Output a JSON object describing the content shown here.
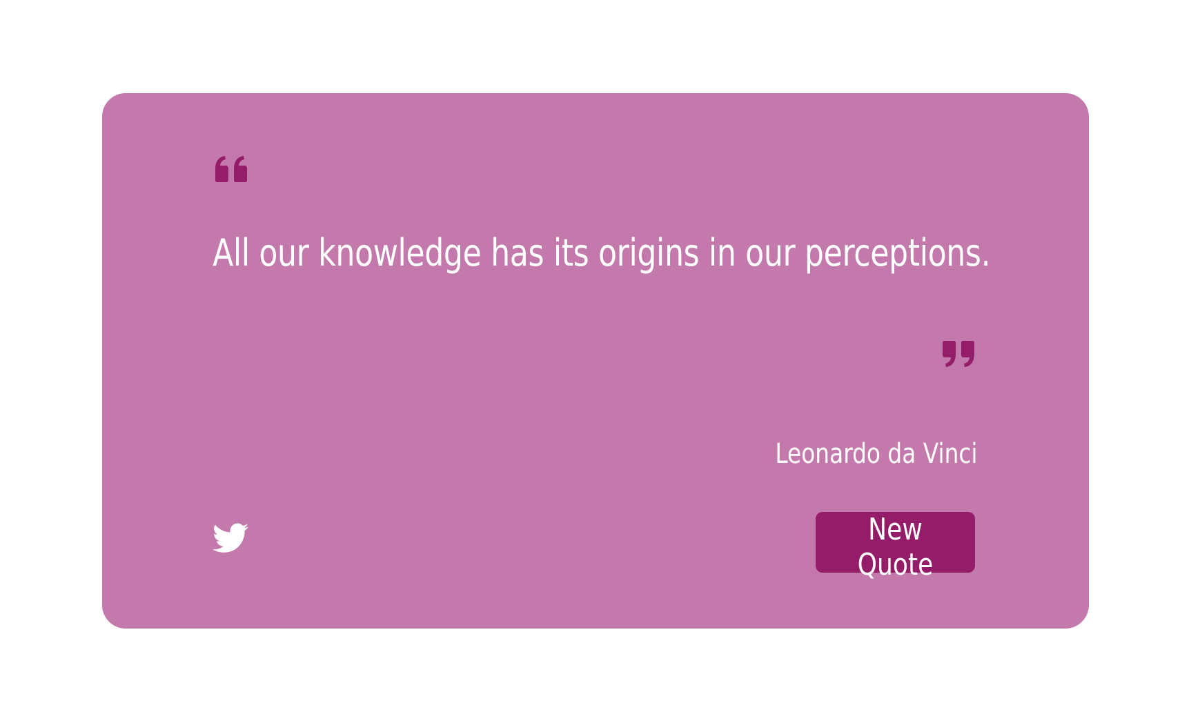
{
  "quote": {
    "text": "All our knowledge has its origins in our perceptions.",
    "author": "Leonardo da Vinci"
  },
  "actions": {
    "new_quote_label": "New Quote",
    "tweet_icon": "twitter-icon"
  },
  "colors": {
    "card_background": "#c479ad",
    "accent": "#941c68",
    "text": "#ffffff",
    "page_background": "#ffffff"
  }
}
